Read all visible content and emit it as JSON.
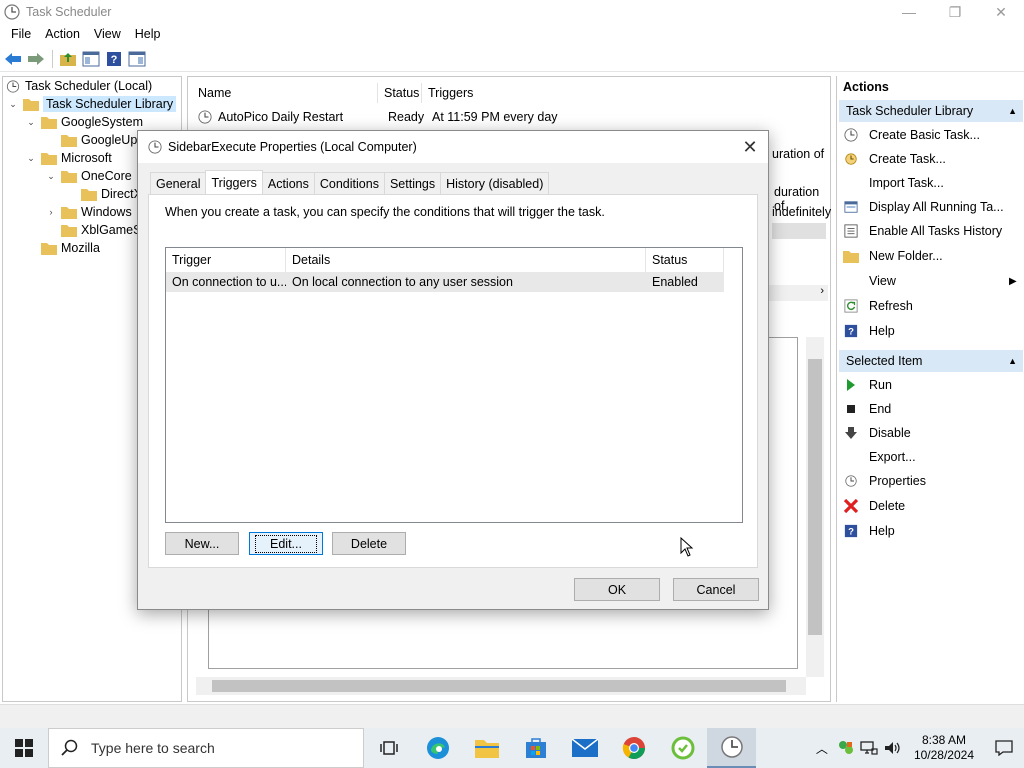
{
  "window": {
    "title": "Task Scheduler",
    "controls": [
      "—",
      "❐",
      "✕"
    ]
  },
  "menu": [
    "File",
    "Action",
    "View",
    "Help"
  ],
  "tree": {
    "items": [
      {
        "label": "Task Scheduler (Local)",
        "exp": "",
        "icon": "clock"
      },
      {
        "label": "Task Scheduler Library",
        "exp": "⌄",
        "icon": "folder",
        "selected": true
      },
      {
        "label": "GoogleSystem",
        "exp": "⌄",
        "icon": "folder"
      },
      {
        "label": "GoogleUp",
        "exp": "",
        "icon": "folder"
      },
      {
        "label": "Microsoft",
        "exp": "⌄",
        "icon": "folder"
      },
      {
        "label": "OneCore",
        "exp": "⌄",
        "icon": "folder"
      },
      {
        "label": "DirectX",
        "exp": "",
        "icon": "folder"
      },
      {
        "label": "Windows",
        "exp": "›",
        "icon": "folder"
      },
      {
        "label": "XblGameS",
        "exp": "",
        "icon": "folder"
      },
      {
        "label": "Mozilla",
        "exp": "",
        "icon": "folder"
      }
    ]
  },
  "task_list": {
    "columns": [
      "Name",
      "Status",
      "Triggers"
    ],
    "row": {
      "name": "AutoPico Daily Restart",
      "status": "Ready",
      "trigger": "At 11:59 PM every day"
    },
    "fragments": [
      "uration of",
      "duration of",
      "indefinitely"
    ]
  },
  "actions": {
    "title": "Actions",
    "section1": "Task Scheduler Library",
    "items1": [
      {
        "label": "Create Basic Task...",
        "icon": "create-basic-task-icon"
      },
      {
        "label": "Create Task...",
        "icon": "create-task-icon"
      },
      {
        "label": "Import Task...",
        "icon": ""
      },
      {
        "label": "Display All Running Ta...",
        "icon": "display-running-icon"
      },
      {
        "label": "Enable All Tasks History",
        "icon": "history-icon"
      },
      {
        "label": "New Folder...",
        "icon": "new-folder-icon"
      },
      {
        "label": "View",
        "icon": "",
        "submenu": true
      },
      {
        "label": "Refresh",
        "icon": "refresh-icon"
      },
      {
        "label": "Help",
        "icon": "help-icon"
      }
    ],
    "section2": "Selected Item",
    "items2": [
      {
        "label": "Run",
        "icon": "run-icon"
      },
      {
        "label": "End",
        "icon": "end-icon"
      },
      {
        "label": "Disable",
        "icon": "disable-icon"
      },
      {
        "label": "Export...",
        "icon": ""
      },
      {
        "label": "Properties",
        "icon": "properties-icon"
      },
      {
        "label": "Delete",
        "icon": "delete-icon"
      },
      {
        "label": "Help",
        "icon": "help-icon"
      }
    ]
  },
  "dialog": {
    "title": "SidebarExecute Properties (Local Computer)",
    "tabs": [
      "General",
      "Triggers",
      "Actions",
      "Conditions",
      "Settings",
      "History (disabled)"
    ],
    "active_tab": "Triggers",
    "description": "When you create a task, you can specify the conditions that will trigger the task.",
    "columns": [
      "Trigger",
      "Details",
      "Status"
    ],
    "rows": [
      {
        "trigger": "On connection to u...",
        "details": "On local connection to any user session",
        "status": "Enabled"
      }
    ],
    "buttons": {
      "new": "New...",
      "edit": "Edit...",
      "delete": "Delete",
      "ok": "OK",
      "cancel": "Cancel"
    }
  },
  "taskbar": {
    "search_placeholder": "Type here to search",
    "time": "8:38 AM",
    "date": "10/28/2024"
  }
}
